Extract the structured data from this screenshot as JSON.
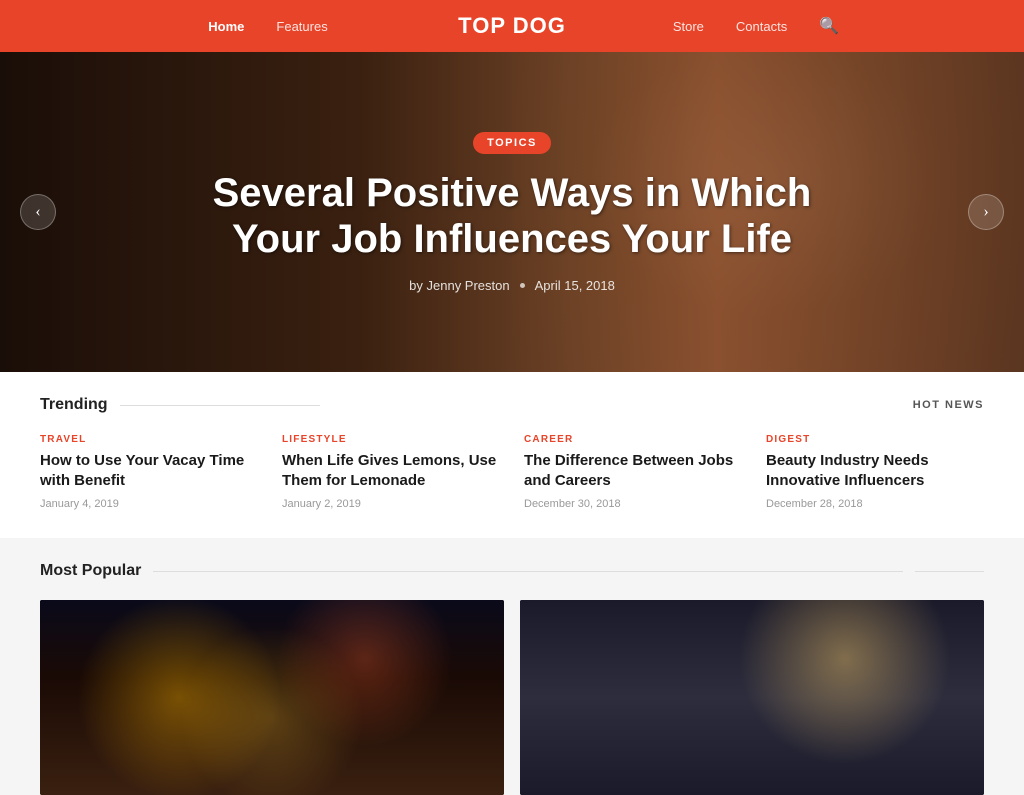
{
  "header": {
    "site_title": "TOP DOG",
    "nav_left": [
      {
        "label": "Home",
        "active": true
      },
      {
        "label": "Features",
        "active": false
      }
    ],
    "nav_right": [
      {
        "label": "Store",
        "active": false
      },
      {
        "label": "Contacts",
        "active": false
      }
    ],
    "search_icon": "🔍"
  },
  "hero": {
    "tag": "TOPICS",
    "title": "Several Positive Ways in Which Your Job Influences Your Life",
    "author": "by Jenny Preston",
    "date": "April 15, 2018",
    "prev_label": "‹",
    "next_label": "›"
  },
  "trending": {
    "section_label": "Trending",
    "hot_news_label": "HOT NEWS",
    "cards": [
      {
        "category": "TRAVEL",
        "title": "How to Use Your Vacay Time with Benefit",
        "date": "January 4, 2019"
      },
      {
        "category": "LIFESTYLE",
        "title": "When Life Gives Lemons, Use Them for Lemonade",
        "date": "January 2, 2019"
      },
      {
        "category": "CAREER",
        "title": "The Difference Between Jobs and Careers",
        "date": "December 30, 2018"
      },
      {
        "category": "DIGEST",
        "title": "Beauty Industry Needs Innovative Influencers",
        "date": "December 28, 2018"
      }
    ]
  },
  "popular": {
    "section_label": "Most Popular",
    "cards": [
      {
        "id": "city-night",
        "alt": "City night street scene with two women"
      },
      {
        "id": "office-team",
        "alt": "Office team working at computers"
      }
    ]
  }
}
